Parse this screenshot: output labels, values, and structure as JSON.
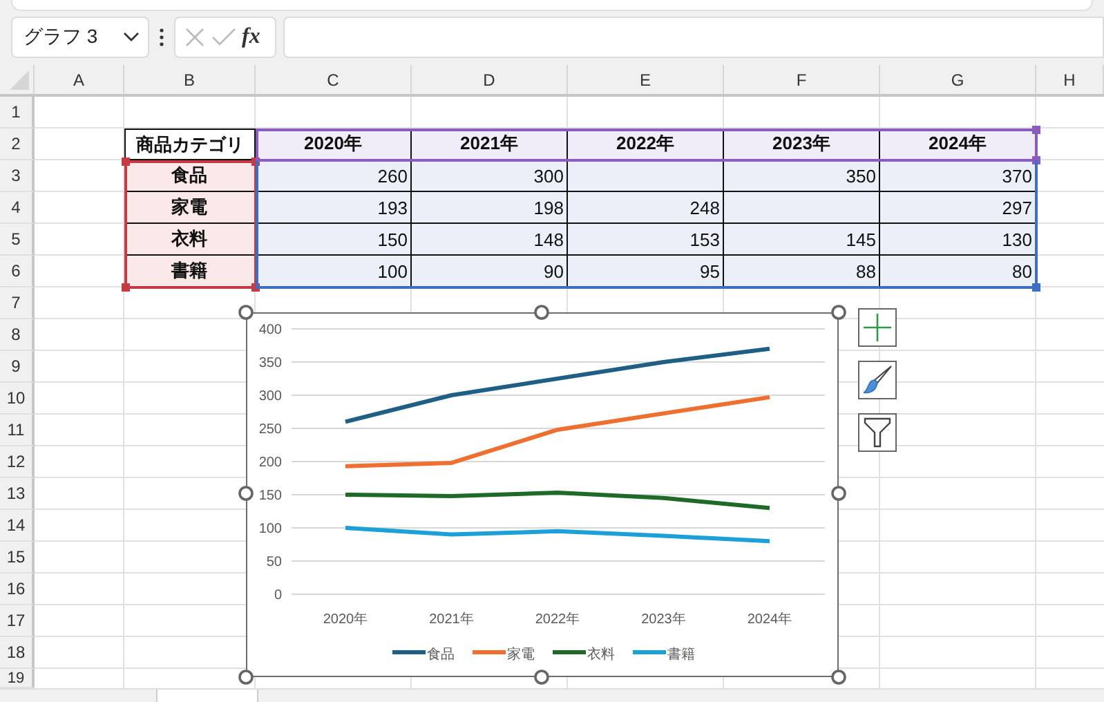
{
  "name_box": {
    "value": "グラフ 3"
  },
  "formula_bar": {
    "fx_label": "fx"
  },
  "sheet": {
    "columns": [
      "A",
      "B",
      "C",
      "D",
      "E",
      "F",
      "G",
      "H"
    ],
    "rows": [
      "1",
      "2",
      "3",
      "4",
      "5",
      "6",
      "7",
      "8",
      "9",
      "10",
      "11",
      "12",
      "13",
      "14",
      "15",
      "16",
      "17",
      "18",
      "19"
    ]
  },
  "table": {
    "header_label": "商品カテゴリ",
    "years": [
      "2020年",
      "2021年",
      "2022年",
      "2023年",
      "2024年"
    ],
    "rows": [
      {
        "category": "食品",
        "cells": [
          {
            "value": "260"
          },
          {
            "value": "300"
          },
          {
            "empty": true
          },
          {
            "value": "350"
          },
          {
            "value": "370"
          }
        ]
      },
      {
        "category": "家電",
        "cells": [
          {
            "value": "193"
          },
          {
            "value": "198"
          },
          {
            "value": "248"
          },
          {
            "empty": true
          },
          {
            "value": "297"
          }
        ]
      },
      {
        "category": "衣料",
        "cells": [
          {
            "value": "150"
          },
          {
            "value": "148"
          },
          {
            "value": "153"
          },
          {
            "value": "145"
          },
          {
            "value": "130"
          }
        ]
      },
      {
        "category": "書籍",
        "cells": [
          {
            "value": "100"
          },
          {
            "value": "90"
          },
          {
            "value": "95"
          },
          {
            "value": "88"
          },
          {
            "value": "80"
          }
        ]
      }
    ]
  },
  "chart": {
    "chart_data": {
      "type": "line",
      "grid": true,
      "legend": true,
      "categories": [
        "2020年",
        "2021年",
        "2022年",
        "2023年",
        "2024年"
      ],
      "ylim": [
        0,
        400
      ],
      "yticks": [
        0,
        50,
        100,
        150,
        200,
        250,
        300,
        350,
        400
      ],
      "series": [
        {
          "name": "食品",
          "color": "#1f5f86",
          "values": [
            260,
            300,
            null,
            350,
            370
          ]
        },
        {
          "name": "家電",
          "color": "#ed7031",
          "values": [
            193,
            198,
            248,
            null,
            297
          ]
        },
        {
          "name": "衣料",
          "color": "#1e6a26",
          "values": [
            150,
            148,
            153,
            145,
            130
          ]
        },
        {
          "name": "書籍",
          "color": "#1ba0d8",
          "values": [
            100,
            90,
            95,
            88,
            80
          ]
        }
      ]
    }
  }
}
